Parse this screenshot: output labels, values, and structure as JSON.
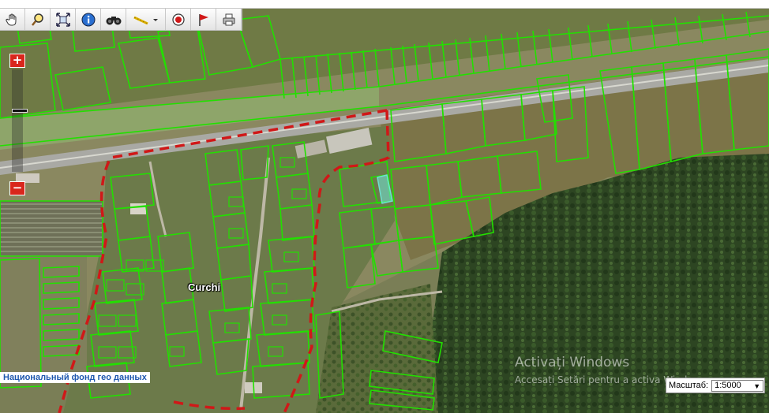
{
  "toolbar": {
    "tools": [
      {
        "name": "pan-hand-icon"
      },
      {
        "name": "search-magnifier-icon"
      },
      {
        "name": "full-extent-icon"
      },
      {
        "name": "info-icon"
      },
      {
        "name": "binoculars-icon"
      },
      {
        "name": "measure-ruler-dropdown-icon"
      },
      {
        "name": "point-marker-icon"
      },
      {
        "name": "flag-icon"
      },
      {
        "name": "print-icon"
      }
    ]
  },
  "zoom": {
    "plus_symbol": "+",
    "minus_symbol": "−",
    "level_fraction": 0.6
  },
  "map": {
    "place_label": "Curchi",
    "attribution": "Национальный фонд гео данных",
    "colors": {
      "parcel_outline": "#22e000",
      "boundary_dash": "#d01818",
      "highlight_parcel": "#6fe0d0",
      "forest": "#2f4a24",
      "field": "#6e7a48"
    }
  },
  "scale": {
    "label": "Масштаб:",
    "selected": "1:5000"
  },
  "os_watermark": {
    "line1": "Activați Windows",
    "line2": "Accesați Setări pentru a activa Windows."
  }
}
